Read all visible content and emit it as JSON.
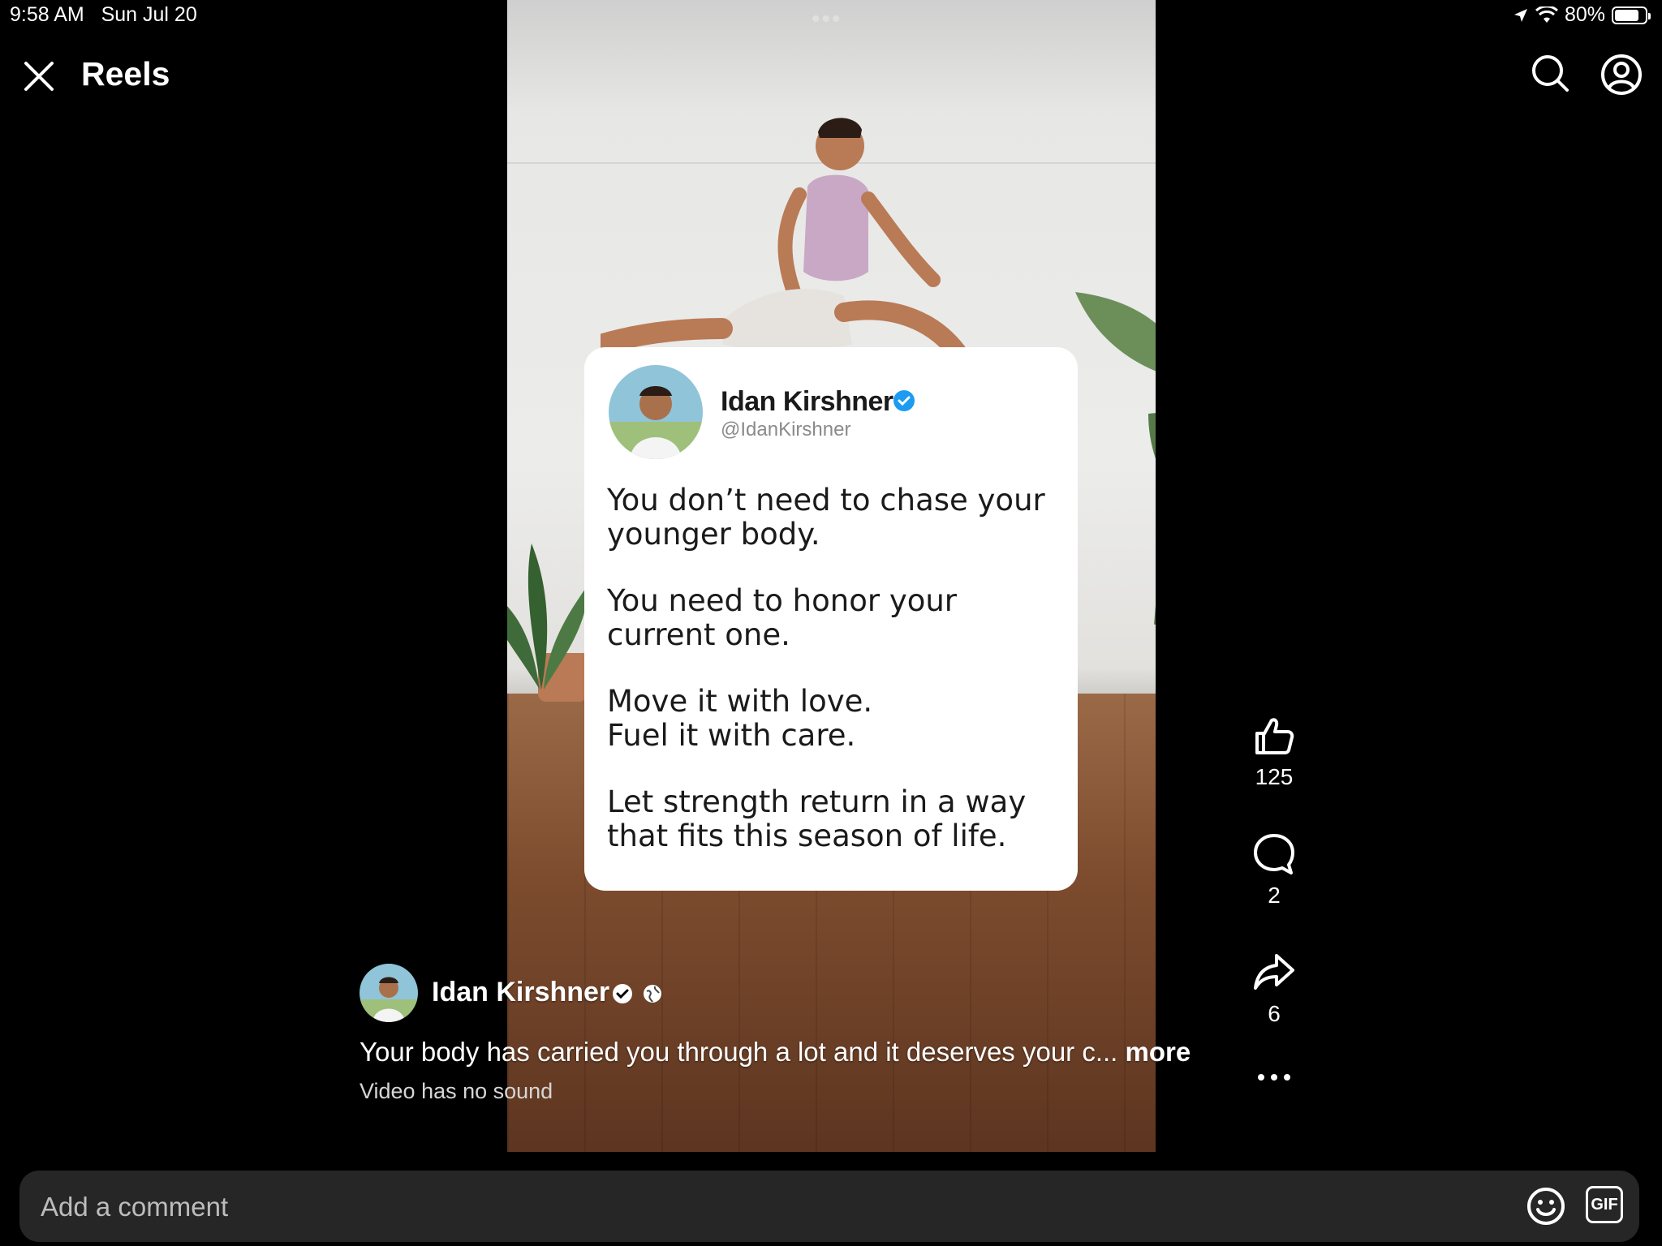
{
  "status_bar": {
    "time": "9:58 AM",
    "date": "Sun Jul 20",
    "battery": "80%",
    "battery_level": 0.8
  },
  "header": {
    "title": "Reels",
    "close_icon": "close-icon",
    "search_icon": "search-icon",
    "profile_icon": "profile-icon"
  },
  "tweet_card": {
    "name": "Idan Kirshner",
    "handle": "@IdanKirshner",
    "paragraphs": [
      "You don’t need to chase your younger body.",
      "You need to honor your current one.",
      "Move it with love.\nFuel it with care.",
      "Let strength return in a way that fits this season of life."
    ]
  },
  "actions": {
    "like_count": "125",
    "comment_count": "2",
    "share_count": "6"
  },
  "caption": {
    "author": "Idan Kirshner",
    "text": "Your body has carried you through a lot and it deserves your c... ",
    "more_label": "more",
    "sound_notice": "Video has no sound"
  },
  "comment_bar": {
    "placeholder": "Add a comment",
    "gif_label": "GIF"
  },
  "colors": {
    "background": "#000000",
    "accent_verified": "#1d9bf0",
    "comment_bar": "#262626"
  }
}
